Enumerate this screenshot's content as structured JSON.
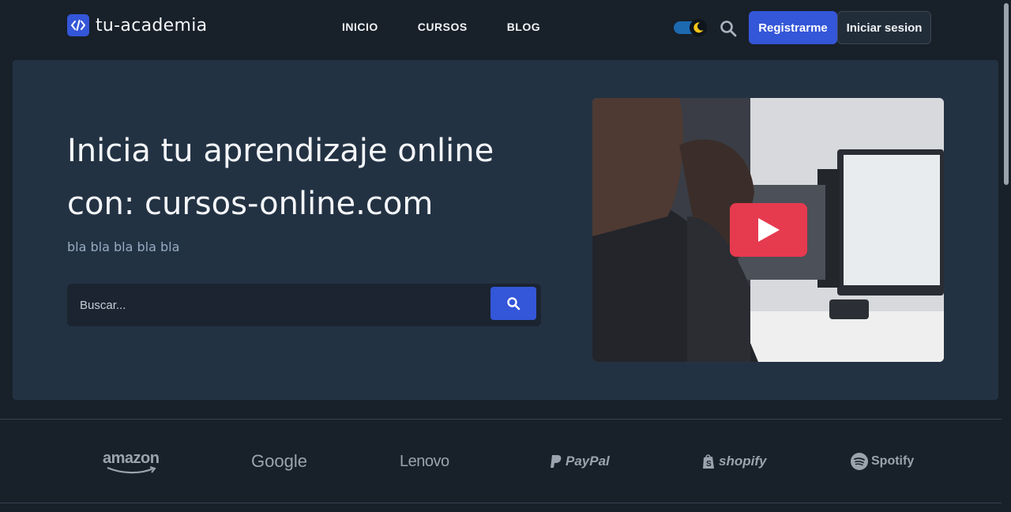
{
  "header": {
    "logo_text": "tu-academia",
    "nav": [
      {
        "label": "INICIO"
      },
      {
        "label": "CURSOS"
      },
      {
        "label": "BLOG"
      }
    ],
    "register_label": "Registrarme",
    "login_label": "Iniciar sesion"
  },
  "hero": {
    "title_line1": "Inicia tu aprendizaje online",
    "title_line2": "con: cursos-online.com",
    "subtitle": "bla bla bla bla bla",
    "search_placeholder": "Buscar..."
  },
  "brands": [
    {
      "name": "amazon",
      "icon": "amazon-logo"
    },
    {
      "name": "Google",
      "icon": "google-logo"
    },
    {
      "name": "Lenovo",
      "icon": "lenovo-logo"
    },
    {
      "name": "PayPal",
      "icon": "paypal-logo"
    },
    {
      "name": "shopify",
      "icon": "shopify-logo"
    },
    {
      "name": "Spotify",
      "icon": "spotify-logo"
    }
  ],
  "colors": {
    "page_bg": "#182029",
    "hero_bg": "#233243",
    "accent": "#3456d8",
    "play": "#e63a4f",
    "muted_text": "#97abc2"
  }
}
